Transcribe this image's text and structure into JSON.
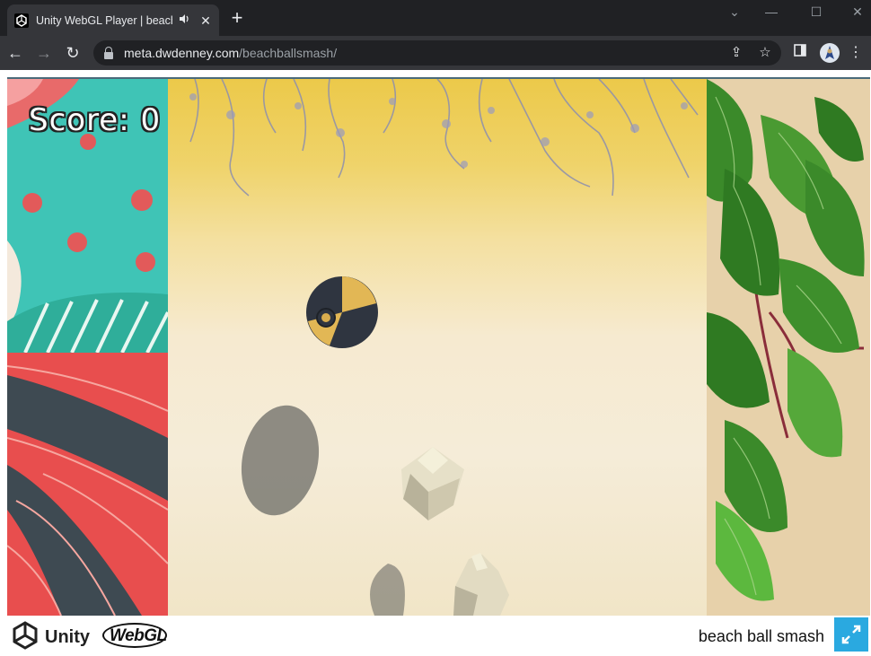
{
  "browser": {
    "tab": {
      "title": "Unity WebGL Player | beach ball smash",
      "favicon": "unity-icon",
      "audio_icon": "speaker-icon",
      "close_icon": "close-icon"
    },
    "new_tab_icon": "plus-icon",
    "window_controls": [
      "chevron-down-icon",
      "minimize-icon",
      "maximize-icon",
      "close-icon"
    ],
    "url_host": "meta.dwdenney.com",
    "url_path": "/beachballsmash/",
    "accent": "#35363a"
  },
  "game": {
    "score_text": "Score: 0"
  },
  "footer": {
    "unity_label": "Unity",
    "webgl_label": "WebGL",
    "title": "beach ball smash",
    "fullscreen_color": "#2aa9e0"
  }
}
